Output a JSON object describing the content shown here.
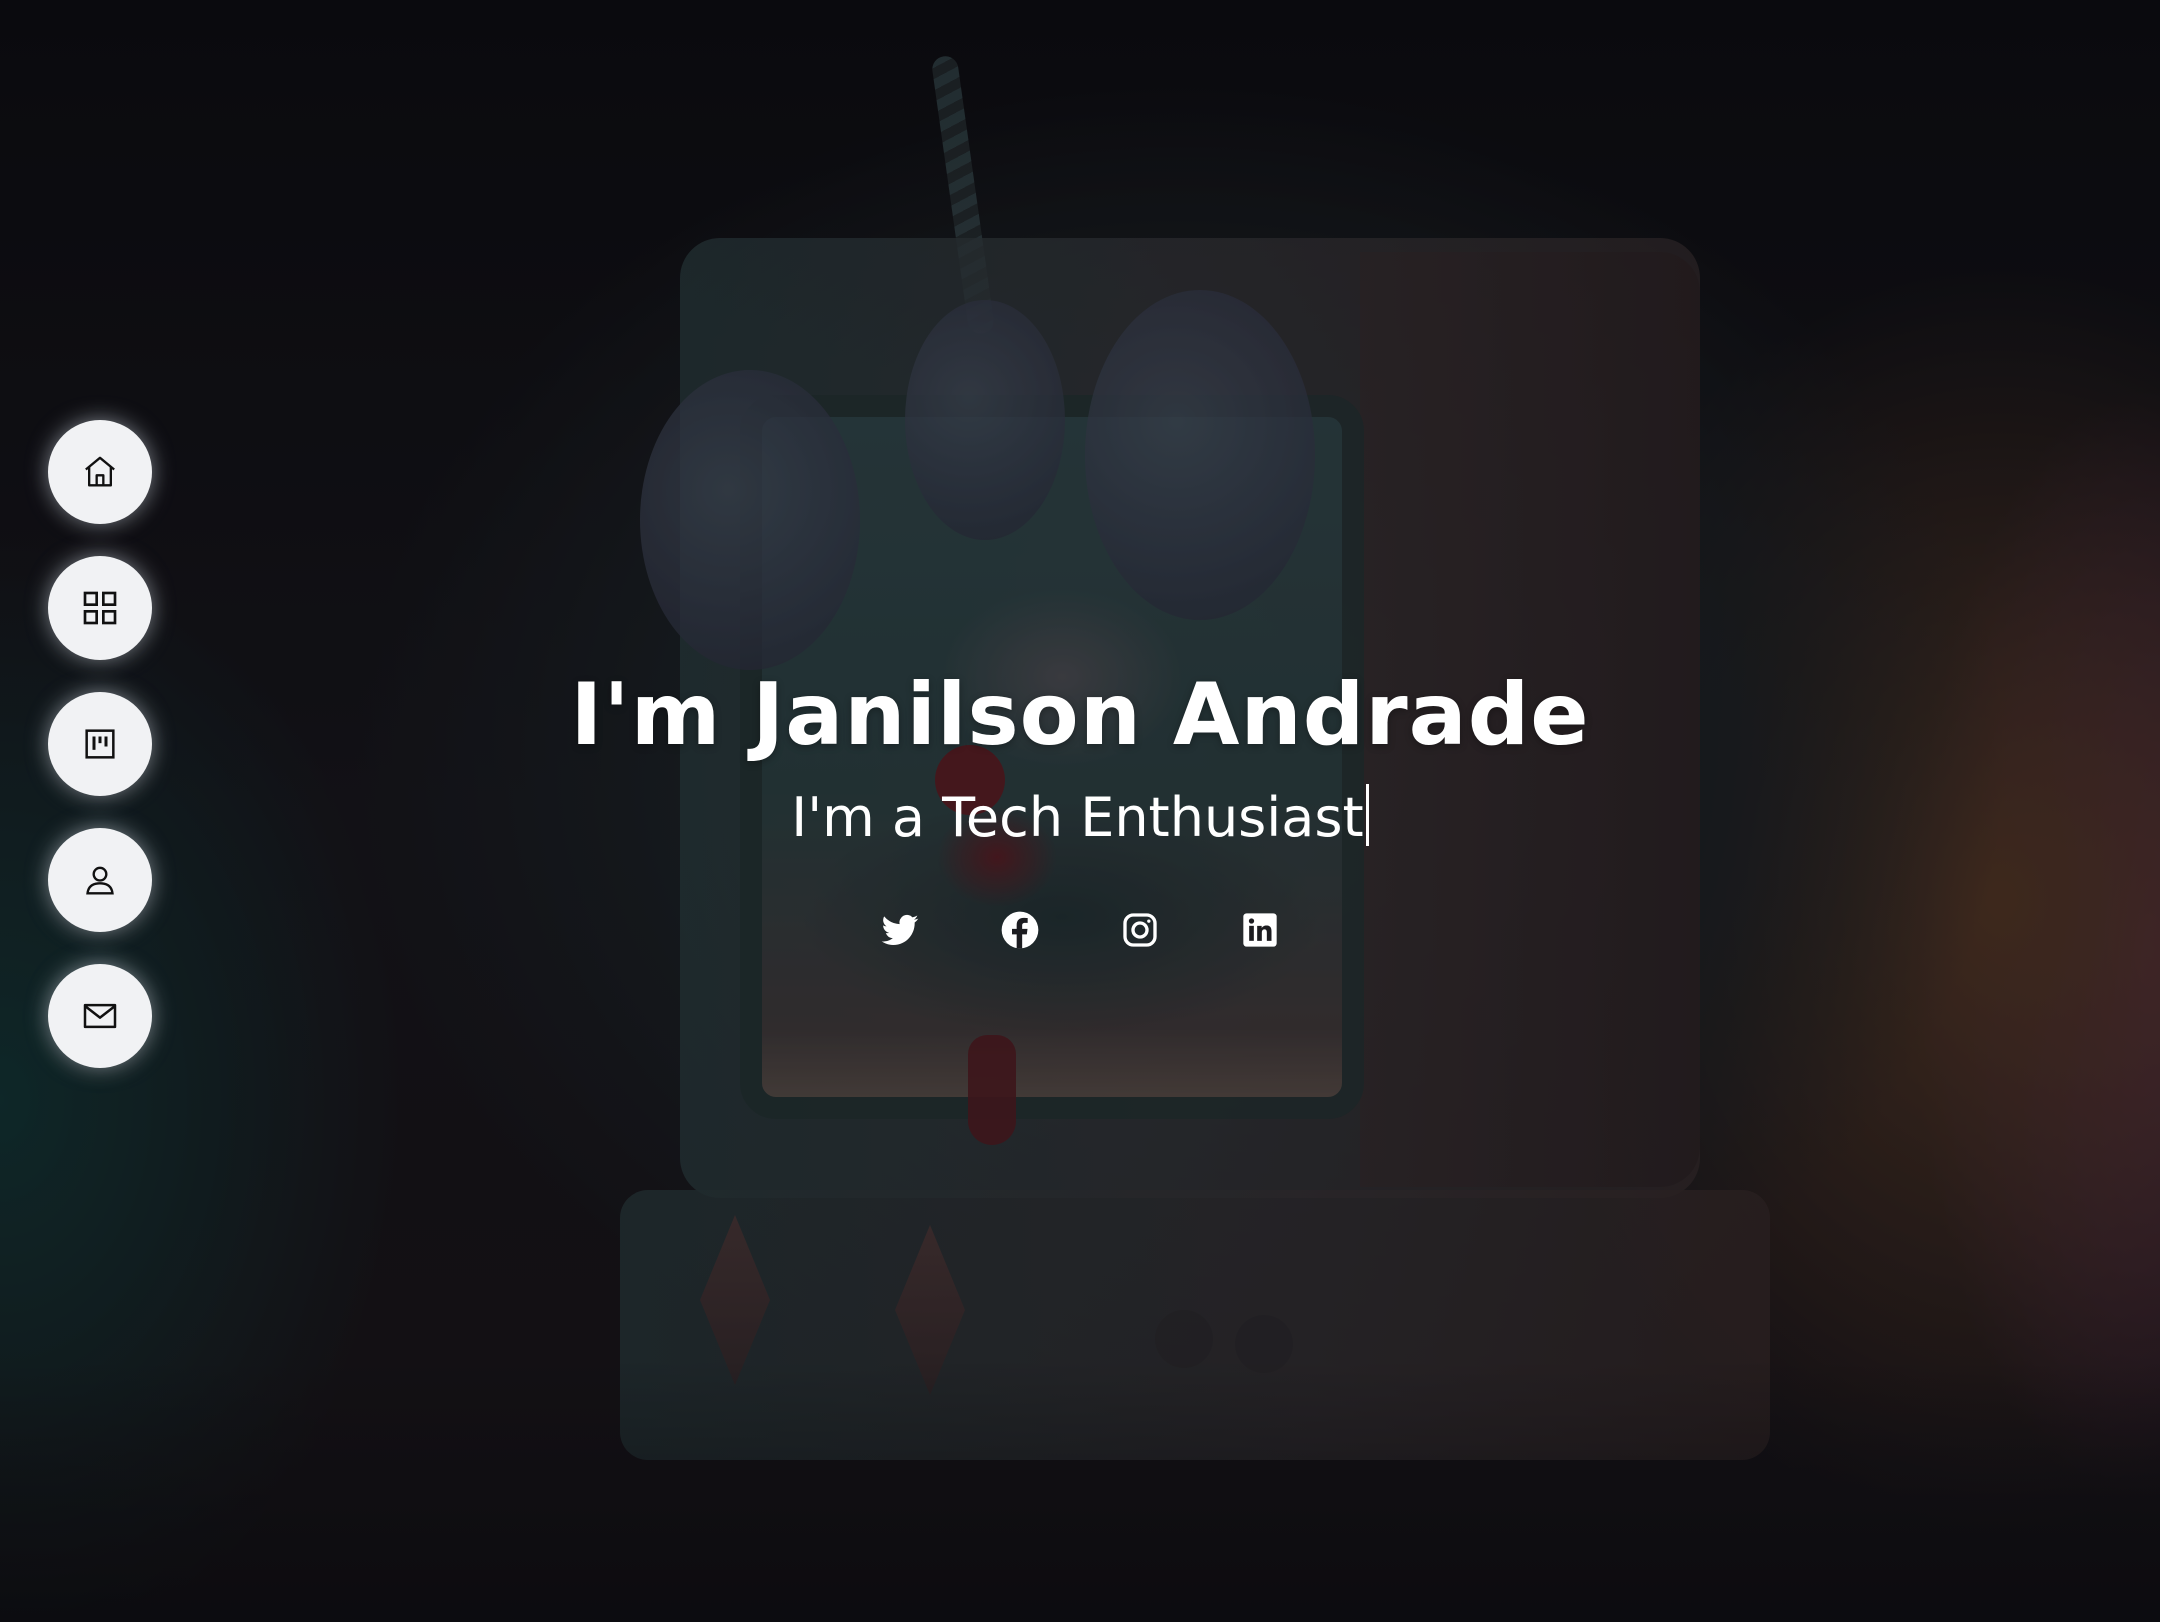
{
  "hero": {
    "title": "I'm Janilson Andrade",
    "subtitle": "I'm a Tech Enthusiast"
  },
  "navigation": [
    {
      "id": "home",
      "icon": "home-icon"
    },
    {
      "id": "grid",
      "icon": "grid-icon"
    },
    {
      "id": "portfolio",
      "icon": "kanban-icon"
    },
    {
      "id": "about",
      "icon": "person-icon"
    },
    {
      "id": "contact",
      "icon": "envelope-icon"
    }
  ],
  "socials": [
    {
      "id": "twitter",
      "icon": "twitter-icon"
    },
    {
      "id": "facebook",
      "icon": "facebook-icon"
    },
    {
      "id": "instagram",
      "icon": "instagram-icon"
    },
    {
      "id": "linkedin",
      "icon": "linkedin-icon"
    }
  ],
  "colors": {
    "nav_button_bg": "#f1f2f4",
    "text": "#ffffff",
    "background": "#0e0d12"
  }
}
